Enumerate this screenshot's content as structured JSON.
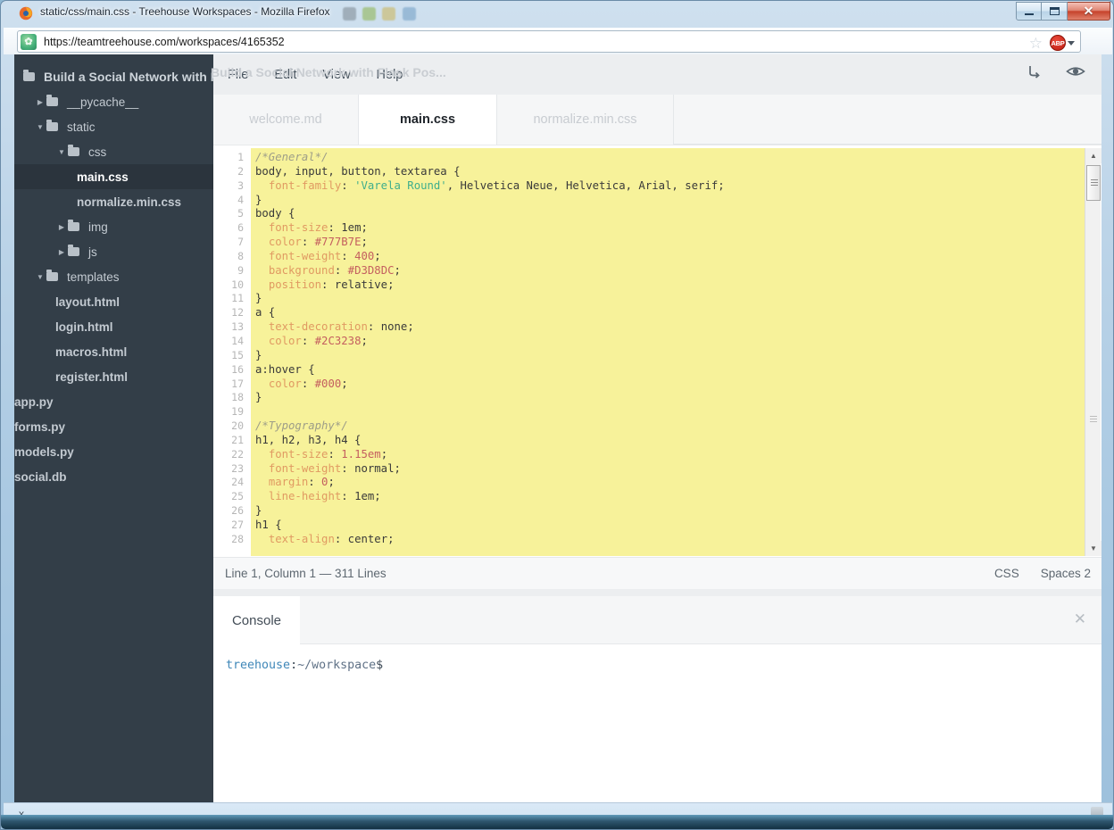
{
  "window": {
    "title": "static/css/main.css - Treehouse Workspaces - Mozilla Firefox",
    "minimize_label": "Minimize",
    "maximize_label": "Maximize",
    "close_label": "Close"
  },
  "browser": {
    "url": "https://teamtreehouse.com/workspaces/4165352",
    "favicon": "treehouse-favicon",
    "bookmark_icon": "star-icon",
    "extension_label": "ABP",
    "extension_icon": "adblock-plus-icon"
  },
  "sidebar": {
    "project_title": "Build a Social Network with Flask Pos...",
    "tree": [
      {
        "label": "__pycache__",
        "type": "folder",
        "indent": 1,
        "expanded": false,
        "selected": false
      },
      {
        "label": "static",
        "type": "folder",
        "indent": 1,
        "expanded": true,
        "selected": false
      },
      {
        "label": "css",
        "type": "folder",
        "indent": 2,
        "expanded": true,
        "selected": false
      },
      {
        "label": "main.css",
        "type": "file",
        "indent": 3,
        "selected": true
      },
      {
        "label": "normalize.min.css",
        "type": "file",
        "indent": 3,
        "selected": false
      },
      {
        "label": "img",
        "type": "folder",
        "indent": 2,
        "expanded": false,
        "selected": false
      },
      {
        "label": "js",
        "type": "folder",
        "indent": 2,
        "expanded": false,
        "selected": false
      },
      {
        "label": "templates",
        "type": "folder",
        "indent": 1,
        "expanded": true,
        "selected": false
      },
      {
        "label": "layout.html",
        "type": "file",
        "indent": 2,
        "selected": false
      },
      {
        "label": "login.html",
        "type": "file",
        "indent": 2,
        "selected": false
      },
      {
        "label": "macros.html",
        "type": "file",
        "indent": 2,
        "selected": false
      },
      {
        "label": "register.html",
        "type": "file",
        "indent": 2,
        "selected": false
      },
      {
        "label": "app.py",
        "type": "file",
        "indent": 1,
        "selected": false
      },
      {
        "label": "forms.py",
        "type": "file",
        "indent": 1,
        "selected": false
      },
      {
        "label": "models.py",
        "type": "file",
        "indent": 1,
        "selected": false
      },
      {
        "label": "social.db",
        "type": "file",
        "indent": 1,
        "selected": false
      }
    ]
  },
  "menubar": {
    "items": [
      "File",
      "Edit",
      "View",
      "Help"
    ],
    "run_icon": "run-arrow-icon",
    "preview_icon": "eye-preview-icon"
  },
  "tabs": [
    {
      "label": "welcome.md",
      "active": false
    },
    {
      "label": "main.css",
      "active": true
    },
    {
      "label": "normalize.min.css",
      "active": false
    }
  ],
  "editor": {
    "first_line": 1,
    "lines": [
      {
        "n": 1,
        "tokens": [
          {
            "t": "/*General*/",
            "c": "cm"
          }
        ]
      },
      {
        "n": 2,
        "tokens": [
          {
            "t": "body, input, button, textarea {",
            "c": "tx"
          }
        ]
      },
      {
        "n": 3,
        "tokens": [
          {
            "t": "  ",
            "c": "tx"
          },
          {
            "t": "font-family",
            "c": "pr"
          },
          {
            "t": ": ",
            "c": "tx"
          },
          {
            "t": "'Varela Round'",
            "c": "st"
          },
          {
            "t": ", Helvetica Neue, Helvetica, Arial, serif;",
            "c": "tx"
          }
        ]
      },
      {
        "n": 4,
        "tokens": [
          {
            "t": "}",
            "c": "tx"
          }
        ]
      },
      {
        "n": 5,
        "tokens": [
          {
            "t": "body {",
            "c": "tx"
          }
        ]
      },
      {
        "n": 6,
        "tokens": [
          {
            "t": "  ",
            "c": "tx"
          },
          {
            "t": "font-size",
            "c": "pr"
          },
          {
            "t": ": ",
            "c": "tx"
          },
          {
            "t": "1em",
            "c": "tx"
          },
          {
            "t": ";",
            "c": "tx"
          }
        ]
      },
      {
        "n": 7,
        "tokens": [
          {
            "t": "  ",
            "c": "tx"
          },
          {
            "t": "color",
            "c": "pr"
          },
          {
            "t": ": ",
            "c": "tx"
          },
          {
            "t": "#777B7E",
            "c": "nm"
          },
          {
            "t": ";",
            "c": "tx"
          }
        ]
      },
      {
        "n": 8,
        "tokens": [
          {
            "t": "  ",
            "c": "tx"
          },
          {
            "t": "font-weight",
            "c": "pr"
          },
          {
            "t": ": ",
            "c": "tx"
          },
          {
            "t": "400",
            "c": "nm"
          },
          {
            "t": ";",
            "c": "tx"
          }
        ]
      },
      {
        "n": 9,
        "tokens": [
          {
            "t": "  ",
            "c": "tx"
          },
          {
            "t": "background",
            "c": "pr"
          },
          {
            "t": ": ",
            "c": "tx"
          },
          {
            "t": "#D3D8DC",
            "c": "nm"
          },
          {
            "t": ";",
            "c": "tx"
          }
        ]
      },
      {
        "n": 10,
        "tokens": [
          {
            "t": "  ",
            "c": "tx"
          },
          {
            "t": "position",
            "c": "pr"
          },
          {
            "t": ": ",
            "c": "tx"
          },
          {
            "t": "relative",
            "c": "tx"
          },
          {
            "t": ";",
            "c": "tx"
          }
        ]
      },
      {
        "n": 11,
        "tokens": [
          {
            "t": "}",
            "c": "tx"
          }
        ]
      },
      {
        "n": 12,
        "tokens": [
          {
            "t": "a {",
            "c": "tx"
          }
        ]
      },
      {
        "n": 13,
        "tokens": [
          {
            "t": "  ",
            "c": "tx"
          },
          {
            "t": "text-decoration",
            "c": "pr"
          },
          {
            "t": ": ",
            "c": "tx"
          },
          {
            "t": "none",
            "c": "tx"
          },
          {
            "t": ";",
            "c": "tx"
          }
        ]
      },
      {
        "n": 14,
        "tokens": [
          {
            "t": "  ",
            "c": "tx"
          },
          {
            "t": "color",
            "c": "pr"
          },
          {
            "t": ": ",
            "c": "tx"
          },
          {
            "t": "#2C3238",
            "c": "nm"
          },
          {
            "t": ";",
            "c": "tx"
          }
        ]
      },
      {
        "n": 15,
        "tokens": [
          {
            "t": "}",
            "c": "tx"
          }
        ]
      },
      {
        "n": 16,
        "tokens": [
          {
            "t": "a:hover {",
            "c": "tx"
          }
        ]
      },
      {
        "n": 17,
        "tokens": [
          {
            "t": "  ",
            "c": "tx"
          },
          {
            "t": "color",
            "c": "pr"
          },
          {
            "t": ": ",
            "c": "tx"
          },
          {
            "t": "#000",
            "c": "nm"
          },
          {
            "t": ";",
            "c": "tx"
          }
        ]
      },
      {
        "n": 18,
        "tokens": [
          {
            "t": "}",
            "c": "tx"
          }
        ]
      },
      {
        "n": 19,
        "tokens": [
          {
            "t": "",
            "c": "tx"
          }
        ]
      },
      {
        "n": 20,
        "tokens": [
          {
            "t": "/*Typography*/",
            "c": "cm"
          }
        ]
      },
      {
        "n": 21,
        "tokens": [
          {
            "t": "h1, h2, h3, h4 {",
            "c": "tx"
          }
        ]
      },
      {
        "n": 22,
        "tokens": [
          {
            "t": "  ",
            "c": "tx"
          },
          {
            "t": "font-size",
            "c": "pr"
          },
          {
            "t": ": ",
            "c": "tx"
          },
          {
            "t": "1.15em",
            "c": "nm"
          },
          {
            "t": ";",
            "c": "tx"
          }
        ]
      },
      {
        "n": 23,
        "tokens": [
          {
            "t": "  ",
            "c": "tx"
          },
          {
            "t": "font-weight",
            "c": "pr"
          },
          {
            "t": ": ",
            "c": "tx"
          },
          {
            "t": "normal",
            "c": "tx"
          },
          {
            "t": ";",
            "c": "tx"
          }
        ]
      },
      {
        "n": 24,
        "tokens": [
          {
            "t": "  ",
            "c": "tx"
          },
          {
            "t": "margin",
            "c": "pr"
          },
          {
            "t": ": ",
            "c": "tx"
          },
          {
            "t": "0",
            "c": "nm"
          },
          {
            "t": ";",
            "c": "tx"
          }
        ]
      },
      {
        "n": 25,
        "tokens": [
          {
            "t": "  ",
            "c": "tx"
          },
          {
            "t": "line-height",
            "c": "pr"
          },
          {
            "t": ": ",
            "c": "tx"
          },
          {
            "t": "1em",
            "c": "tx"
          },
          {
            "t": ";",
            "c": "tx"
          }
        ]
      },
      {
        "n": 26,
        "tokens": [
          {
            "t": "}",
            "c": "tx"
          }
        ]
      },
      {
        "n": 27,
        "tokens": [
          {
            "t": "h1 {",
            "c": "tx"
          }
        ]
      },
      {
        "n": 28,
        "tokens": [
          {
            "t": "  ",
            "c": "tx"
          },
          {
            "t": "text-align",
            "c": "pr"
          },
          {
            "t": ": ",
            "c": "tx"
          },
          {
            "t": "center",
            "c": "tx"
          },
          {
            "t": ";",
            "c": "tx"
          }
        ]
      }
    ]
  },
  "statusbar": {
    "position": "Line 1, Column 1 — 311 Lines",
    "language": "CSS",
    "indent": "Spaces 2"
  },
  "console": {
    "tab_label": "Console",
    "close_icon": "close-icon",
    "prompt_user": "treehouse",
    "prompt_sep": ":",
    "prompt_path": "~/workspace",
    "prompt_symbol": "$"
  },
  "findbar": {
    "close_label": "x"
  },
  "colors": {
    "sidebar_bg": "#333e48",
    "editor_bg": "#f7f29a",
    "accent_close": "#c6432c",
    "tab_active_bg": "#ffffff"
  }
}
